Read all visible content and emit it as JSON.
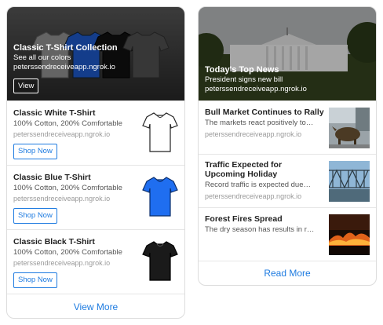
{
  "left_card": {
    "hero": {
      "title": "Classic T-Shirt Collection",
      "subtitle": "See all our colors",
      "url": "peterssendreceiveapp.ngrok.io",
      "button_label": "View"
    },
    "items": [
      {
        "title": "Classic White T-Shirt",
        "subtitle": "100% Cotton, 200% Comfortable",
        "url": "peterssendreceiveapp.ngrok.io",
        "button_label": "Shop Now",
        "shirt_color": "#ffffff",
        "icon": "white-tshirt-icon"
      },
      {
        "title": "Classic Blue T-Shirt",
        "subtitle": "100% Cotton, 200% Comfortable",
        "url": "peterssendreceiveapp.ngrok.io",
        "button_label": "Shop Now",
        "shirt_color": "#1f6ef0",
        "icon": "blue-tshirt-icon"
      },
      {
        "title": "Classic Black T-Shirt",
        "subtitle": "100% Cotton, 200% Comfortable",
        "url": "peterssendreceiveapp.ngrok.io",
        "button_label": "Shop Now",
        "shirt_color": "#1a1a1a",
        "icon": "black-tshirt-icon"
      }
    ],
    "footer_label": "View More"
  },
  "right_card": {
    "hero": {
      "title": "Today's Top News",
      "subtitle": "President signs new bill",
      "url": "peterssendreceiveapp.ngrok.io"
    },
    "items": [
      {
        "title_lines": [
          "Bull Market Continues to Rally"
        ],
        "subtitle": "The markets react positively to…",
        "url": "peterssendreceiveapp.ngrok.io",
        "icon": "bull-statue-image"
      },
      {
        "title_lines": [
          "Traffic Expected for",
          "Upcoming Holiday"
        ],
        "subtitle": "Record traffic is expected due…",
        "url": "peterssendreceiveapp.ngrok.io",
        "icon": "bridge-image"
      },
      {
        "title_lines": [
          "Forest Fires Spread"
        ],
        "subtitle": "The dry season has results in r…",
        "url": "",
        "icon": "forest-fire-image"
      }
    ],
    "footer_label": "Read More"
  },
  "colors": {
    "accent": "#1e7be0",
    "border": "#dcdcdc"
  }
}
